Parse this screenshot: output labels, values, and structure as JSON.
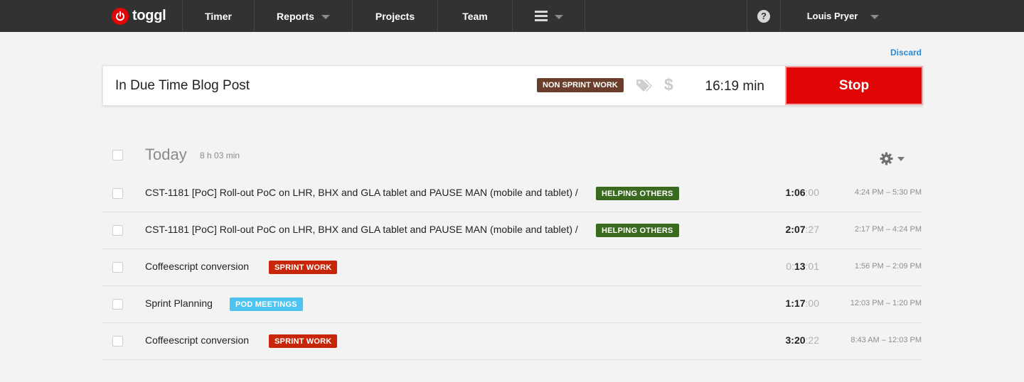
{
  "nav": {
    "logo_text": "toggl",
    "timer": "Timer",
    "reports": "Reports",
    "projects": "Projects",
    "team": "Team",
    "help": "?",
    "user": "Louis Pryer"
  },
  "discard_label": "Discard",
  "timer": {
    "description": "In Due Time Blog Post",
    "project": "NON SPRINT WORK",
    "project_color": "#6b3d2b",
    "tag_icon": "tag-icon",
    "billable_icon": "dollar-icon",
    "duration": "16:19 min",
    "stop_label": "Stop",
    "stop_color": "#e20505"
  },
  "day": {
    "title": "Today",
    "total": "8 h 03 min"
  },
  "entries": [
    {
      "description": "CST-1181 [PoC] Roll-out PoC on LHR, BHX and GLA tablet and PAUSE MAN (mobile and tablet) /",
      "tag": "HELPING OTHERS",
      "tag_color": "#3a6a1f",
      "duration_pre": "",
      "duration_main": "1:06",
      "duration_sec": ":00",
      "range": "4:24 PM – 5:30 PM"
    },
    {
      "description": "CST-1181 [PoC] Roll-out PoC on LHR, BHX and GLA tablet and PAUSE MAN (mobile and tablet) /",
      "tag": "HELPING OTHERS",
      "tag_color": "#3a6a1f",
      "duration_pre": "",
      "duration_main": "2:07",
      "duration_sec": ":27",
      "range": "2:17 PM – 4:24 PM"
    },
    {
      "description": "Coffeescript conversion",
      "tag": "SPRINT WORK",
      "tag_color": "#c7260a",
      "duration_pre": "0:",
      "duration_main": "13",
      "duration_sec": ":01",
      "range": "1:56 PM – 2:09 PM"
    },
    {
      "description": "Sprint Planning",
      "tag": "POD MEETINGS",
      "tag_color": "#4dc3f0",
      "duration_pre": "",
      "duration_main": "1:17",
      "duration_sec": ":00",
      "range": "12:03 PM – 1:20 PM"
    },
    {
      "description": "Coffeescript conversion",
      "tag": "SPRINT WORK",
      "tag_color": "#c7260a",
      "duration_pre": "",
      "duration_main": "3:20",
      "duration_sec": ":22",
      "range": "8:43 AM – 12:03 PM"
    }
  ]
}
